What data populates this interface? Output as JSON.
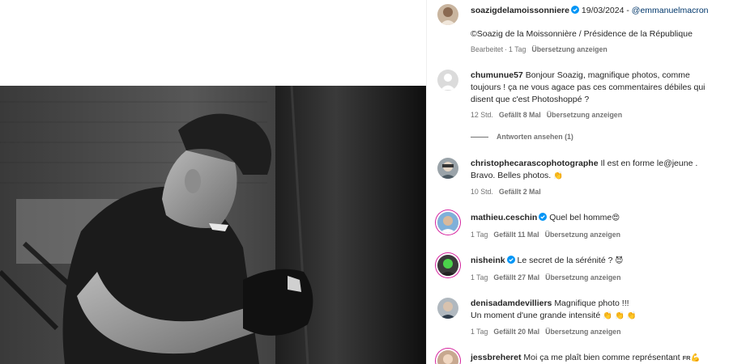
{
  "post": {
    "author": "soazigdelamoissonniere",
    "date": "19/03/2024",
    "separator": "-",
    "mention": "@emmanuelmacron",
    "caption": "©Soazig de la Moissonnière / Présidence de la République",
    "meta": {
      "edited": "Bearbeitet",
      "dot": "·",
      "time": "1 Tag",
      "translate": "Übersetzung anzeigen"
    }
  },
  "comments": [
    {
      "username": "chumunue57",
      "verified": false,
      "text_lines": [
        "Bonjour Soazig, magnifique photos, comme",
        "toujours ! ça ne vous agace pas ces commentaires débiles qui",
        "disent que c'est Photoshoppé ?"
      ],
      "time": "12 Std.",
      "likes": "Gefällt 8 Mal",
      "translate": "Übersetzung anzeigen",
      "replies": "Antworten ansehen (1)"
    },
    {
      "username": "christophecarascophotographe",
      "verified": false,
      "text_lines": [
        "Il est en forme le@jeune .",
        "Bravo. Belles photos."
      ],
      "emoji": "👏",
      "time": "10 Std.",
      "likes": "Gefällt 2 Mal"
    },
    {
      "username": "mathieu.ceschin",
      "verified": true,
      "text": "Quel bel homme",
      "emoji": "😍",
      "time": "1 Tag",
      "likes": "Gefällt 11 Mal",
      "translate": "Übersetzung anzeigen"
    },
    {
      "username": "nisheink",
      "verified": true,
      "text": "Le secret de la sérénité ?",
      "emoji": "😈",
      "time": "1 Tag",
      "likes": "Gefällt 27 Mal",
      "translate": "Übersetzung anzeigen"
    },
    {
      "username": "denisadamdevilliers",
      "verified": false,
      "text_lines": [
        "Magnifique photo !!!",
        "Un moment d'une grande intensité"
      ],
      "emoji": "👏 👏 👏",
      "time": "1 Tag",
      "likes": "Gefällt 20 Mal",
      "translate": "Übersetzung anzeigen"
    },
    {
      "username": "jessbreheret",
      "verified": false,
      "text": "Moi ça me plaît bien comme représentant",
      "flag": "FR",
      "emoji": "💪"
    }
  ],
  "icons": {
    "verified": "verified-badge-icon",
    "avatar": "avatar-image"
  },
  "colors": {
    "verified": "#0095f6",
    "mention": "#00376b",
    "meta": "#737373",
    "text": "#262626"
  }
}
